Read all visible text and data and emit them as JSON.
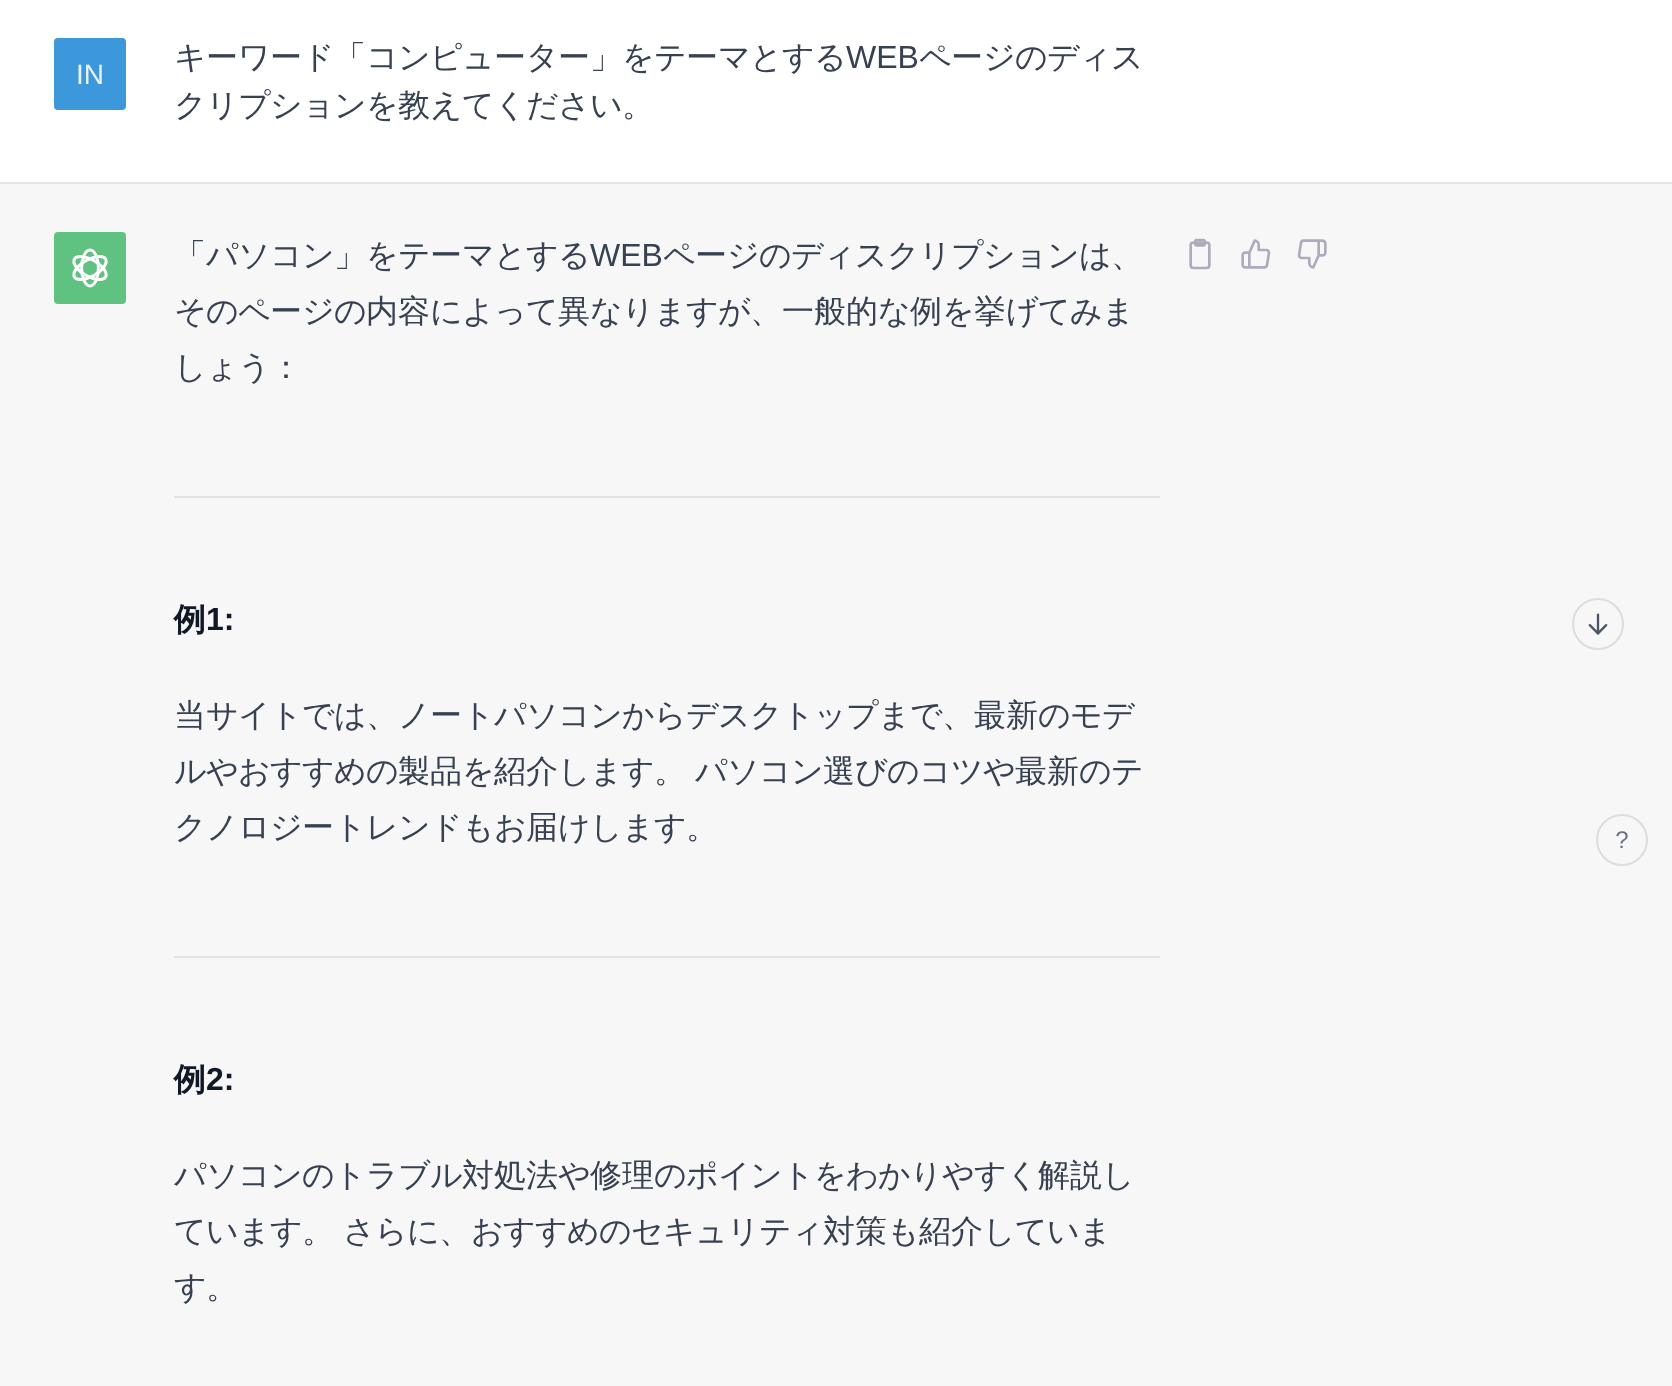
{
  "messages": [
    {
      "kind": "user",
      "avatar": "IN",
      "blocks": [
        {
          "kind": "paragraph",
          "text": "キーワード「コンピューター」をテーマとするWEBページのディスクリプションを教えてください。"
        }
      ]
    },
    {
      "kind": "assistant",
      "blocks": [
        {
          "kind": "paragraph",
          "text": "「パソコン」をテーマとするWEBページのディスクリプションは、そのページの内容によって異なりますが、一般的な例を挙げてみましょう："
        },
        {
          "kind": "rule"
        },
        {
          "kind": "heading",
          "text": "例1:"
        },
        {
          "kind": "paragraph",
          "text": "当サイトでは、ノートパソコンからデスクトップまで、最新のモデルやおすすめの製品を紹介します。 パソコン選びのコツや最新のテクノロジートレンドもお届けします。"
        },
        {
          "kind": "rule"
        },
        {
          "kind": "heading",
          "text": "例2:"
        },
        {
          "kind": "paragraph",
          "text": "パソコンのトラブル対処法や修理のポイントをわかりやすく解説しています。 さらに、おすすめのセキュリティ対策も紹介しています。"
        }
      ]
    }
  ],
  "help_button": {
    "label": "?"
  }
}
